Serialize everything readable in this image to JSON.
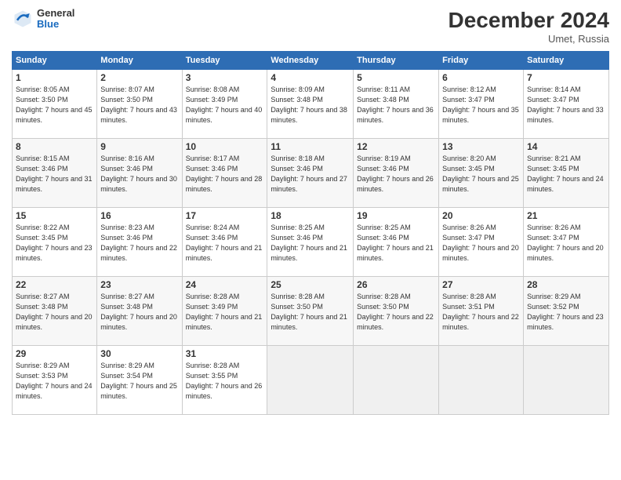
{
  "header": {
    "logo_general": "General",
    "logo_blue": "Blue",
    "title": "December 2024",
    "location": "Umet, Russia"
  },
  "columns": [
    "Sunday",
    "Monday",
    "Tuesday",
    "Wednesday",
    "Thursday",
    "Friday",
    "Saturday"
  ],
  "weeks": [
    [
      {
        "day": "1",
        "sunrise": "Sunrise: 8:05 AM",
        "sunset": "Sunset: 3:50 PM",
        "daylight": "Daylight: 7 hours and 45 minutes."
      },
      {
        "day": "2",
        "sunrise": "Sunrise: 8:07 AM",
        "sunset": "Sunset: 3:50 PM",
        "daylight": "Daylight: 7 hours and 43 minutes."
      },
      {
        "day": "3",
        "sunrise": "Sunrise: 8:08 AM",
        "sunset": "Sunset: 3:49 PM",
        "daylight": "Daylight: 7 hours and 40 minutes."
      },
      {
        "day": "4",
        "sunrise": "Sunrise: 8:09 AM",
        "sunset": "Sunset: 3:48 PM",
        "daylight": "Daylight: 7 hours and 38 minutes."
      },
      {
        "day": "5",
        "sunrise": "Sunrise: 8:11 AM",
        "sunset": "Sunset: 3:48 PM",
        "daylight": "Daylight: 7 hours and 36 minutes."
      },
      {
        "day": "6",
        "sunrise": "Sunrise: 8:12 AM",
        "sunset": "Sunset: 3:47 PM",
        "daylight": "Daylight: 7 hours and 35 minutes."
      },
      {
        "day": "7",
        "sunrise": "Sunrise: 8:14 AM",
        "sunset": "Sunset: 3:47 PM",
        "daylight": "Daylight: 7 hours and 33 minutes."
      }
    ],
    [
      {
        "day": "8",
        "sunrise": "Sunrise: 8:15 AM",
        "sunset": "Sunset: 3:46 PM",
        "daylight": "Daylight: 7 hours and 31 minutes."
      },
      {
        "day": "9",
        "sunrise": "Sunrise: 8:16 AM",
        "sunset": "Sunset: 3:46 PM",
        "daylight": "Daylight: 7 hours and 30 minutes."
      },
      {
        "day": "10",
        "sunrise": "Sunrise: 8:17 AM",
        "sunset": "Sunset: 3:46 PM",
        "daylight": "Daylight: 7 hours and 28 minutes."
      },
      {
        "day": "11",
        "sunrise": "Sunrise: 8:18 AM",
        "sunset": "Sunset: 3:46 PM",
        "daylight": "Daylight: 7 hours and 27 minutes."
      },
      {
        "day": "12",
        "sunrise": "Sunrise: 8:19 AM",
        "sunset": "Sunset: 3:46 PM",
        "daylight": "Daylight: 7 hours and 26 minutes."
      },
      {
        "day": "13",
        "sunrise": "Sunrise: 8:20 AM",
        "sunset": "Sunset: 3:45 PM",
        "daylight": "Daylight: 7 hours and 25 minutes."
      },
      {
        "day": "14",
        "sunrise": "Sunrise: 8:21 AM",
        "sunset": "Sunset: 3:45 PM",
        "daylight": "Daylight: 7 hours and 24 minutes."
      }
    ],
    [
      {
        "day": "15",
        "sunrise": "Sunrise: 8:22 AM",
        "sunset": "Sunset: 3:45 PM",
        "daylight": "Daylight: 7 hours and 23 minutes."
      },
      {
        "day": "16",
        "sunrise": "Sunrise: 8:23 AM",
        "sunset": "Sunset: 3:46 PM",
        "daylight": "Daylight: 7 hours and 22 minutes."
      },
      {
        "day": "17",
        "sunrise": "Sunrise: 8:24 AM",
        "sunset": "Sunset: 3:46 PM",
        "daylight": "Daylight: 7 hours and 21 minutes."
      },
      {
        "day": "18",
        "sunrise": "Sunrise: 8:25 AM",
        "sunset": "Sunset: 3:46 PM",
        "daylight": "Daylight: 7 hours and 21 minutes."
      },
      {
        "day": "19",
        "sunrise": "Sunrise: 8:25 AM",
        "sunset": "Sunset: 3:46 PM",
        "daylight": "Daylight: 7 hours and 21 minutes."
      },
      {
        "day": "20",
        "sunrise": "Sunrise: 8:26 AM",
        "sunset": "Sunset: 3:47 PM",
        "daylight": "Daylight: 7 hours and 20 minutes."
      },
      {
        "day": "21",
        "sunrise": "Sunrise: 8:26 AM",
        "sunset": "Sunset: 3:47 PM",
        "daylight": "Daylight: 7 hours and 20 minutes."
      }
    ],
    [
      {
        "day": "22",
        "sunrise": "Sunrise: 8:27 AM",
        "sunset": "Sunset: 3:48 PM",
        "daylight": "Daylight: 7 hours and 20 minutes."
      },
      {
        "day": "23",
        "sunrise": "Sunrise: 8:27 AM",
        "sunset": "Sunset: 3:48 PM",
        "daylight": "Daylight: 7 hours and 20 minutes."
      },
      {
        "day": "24",
        "sunrise": "Sunrise: 8:28 AM",
        "sunset": "Sunset: 3:49 PM",
        "daylight": "Daylight: 7 hours and 21 minutes."
      },
      {
        "day": "25",
        "sunrise": "Sunrise: 8:28 AM",
        "sunset": "Sunset: 3:50 PM",
        "daylight": "Daylight: 7 hours and 21 minutes."
      },
      {
        "day": "26",
        "sunrise": "Sunrise: 8:28 AM",
        "sunset": "Sunset: 3:50 PM",
        "daylight": "Daylight: 7 hours and 22 minutes."
      },
      {
        "day": "27",
        "sunrise": "Sunrise: 8:28 AM",
        "sunset": "Sunset: 3:51 PM",
        "daylight": "Daylight: 7 hours and 22 minutes."
      },
      {
        "day": "28",
        "sunrise": "Sunrise: 8:29 AM",
        "sunset": "Sunset: 3:52 PM",
        "daylight": "Daylight: 7 hours and 23 minutes."
      }
    ],
    [
      {
        "day": "29",
        "sunrise": "Sunrise: 8:29 AM",
        "sunset": "Sunset: 3:53 PM",
        "daylight": "Daylight: 7 hours and 24 minutes."
      },
      {
        "day": "30",
        "sunrise": "Sunrise: 8:29 AM",
        "sunset": "Sunset: 3:54 PM",
        "daylight": "Daylight: 7 hours and 25 minutes."
      },
      {
        "day": "31",
        "sunrise": "Sunrise: 8:28 AM",
        "sunset": "Sunset: 3:55 PM",
        "daylight": "Daylight: 7 hours and 26 minutes."
      },
      null,
      null,
      null,
      null
    ]
  ]
}
